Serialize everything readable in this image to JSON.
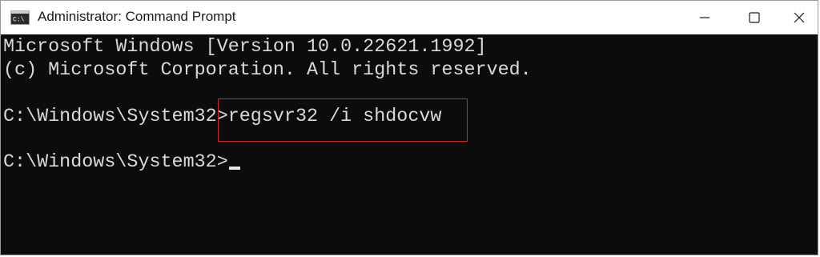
{
  "window": {
    "title": "Administrator: Command Prompt",
    "app_icon": "command-prompt-icon",
    "controls": [
      "minimize-icon",
      "maximize-icon",
      "close-icon"
    ]
  },
  "terminal": {
    "lines": [
      "Microsoft Windows [Version 10.0.22621.1992]",
      "(c) Microsoft Corporation. All rights reserved.",
      "",
      "C:\\Windows\\System32>regsvr32 /i shdocvw",
      "",
      "C:\\Windows\\System32>"
    ],
    "prompt": "C:\\Windows\\System32>",
    "command": "regsvr32 /i shdocvw",
    "highlight_color": "#c62828",
    "background_color": "#0c0c0c",
    "text_color": "#d9d9d9"
  }
}
